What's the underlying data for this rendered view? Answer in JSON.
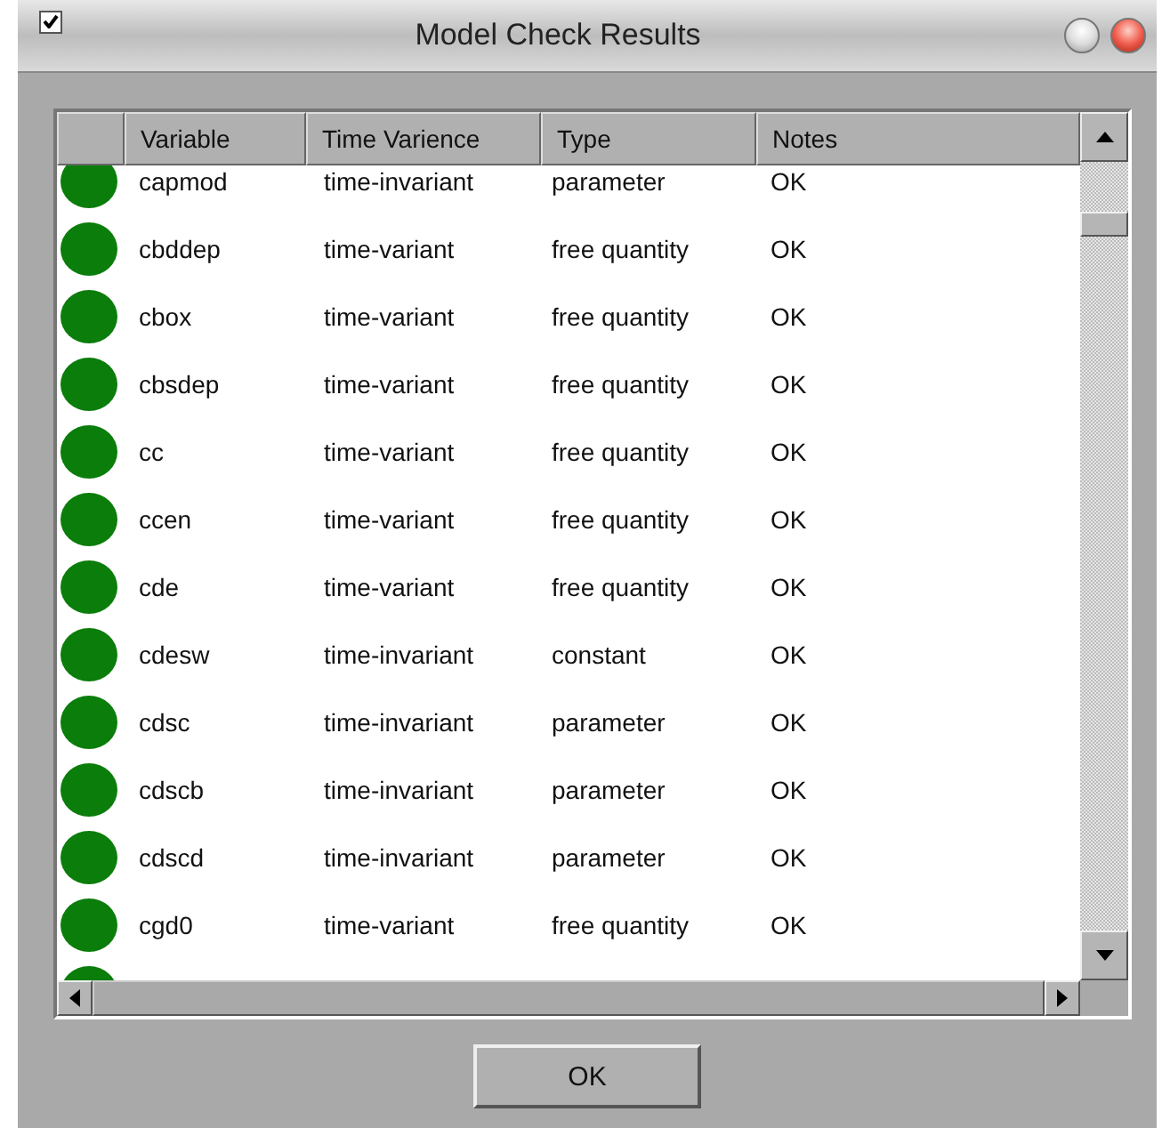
{
  "window": {
    "title": "Model Check Results",
    "menu_checked": true
  },
  "table": {
    "columns": [
      "Variable",
      "Time Varience",
      "Type",
      "Notes"
    ],
    "rows": [
      {
        "color": "#0a7d0a",
        "cells": [
          "capmod",
          "time-invariant",
          "parameter",
          "OK"
        ]
      },
      {
        "color": "#0a7d0a",
        "cells": [
          "cbddep",
          "time-variant",
          "free quantity",
          "OK"
        ]
      },
      {
        "color": "#0a7d0a",
        "cells": [
          "cbox",
          "time-variant",
          "free quantity",
          "OK"
        ]
      },
      {
        "color": "#0a7d0a",
        "cells": [
          "cbsdep",
          "time-variant",
          "free quantity",
          "OK"
        ]
      },
      {
        "color": "#0a7d0a",
        "cells": [
          "cc",
          "time-variant",
          "free quantity",
          "OK"
        ]
      },
      {
        "color": "#0a7d0a",
        "cells": [
          "ccen",
          "time-variant",
          "free quantity",
          "OK"
        ]
      },
      {
        "color": "#0a7d0a",
        "cells": [
          "cde",
          "time-variant",
          "free quantity",
          "OK"
        ]
      },
      {
        "color": "#0a7d0a",
        "cells": [
          "cdesw",
          "time-invariant",
          "constant",
          "OK"
        ]
      },
      {
        "color": "#0a7d0a",
        "cells": [
          "cdsc",
          "time-invariant",
          "parameter",
          "OK"
        ]
      },
      {
        "color": "#0a7d0a",
        "cells": [
          "cdscb",
          "time-invariant",
          "parameter",
          "OK"
        ]
      },
      {
        "color": "#0a7d0a",
        "cells": [
          "cdscd",
          "time-invariant",
          "parameter",
          "OK"
        ]
      },
      {
        "color": "#0a7d0a",
        "cells": [
          "cgd0",
          "time-variant",
          "free quantity",
          "OK"
        ]
      },
      {
        "color": "#0a7d0a"
      }
    ]
  },
  "buttons": [
    "OK"
  ]
}
